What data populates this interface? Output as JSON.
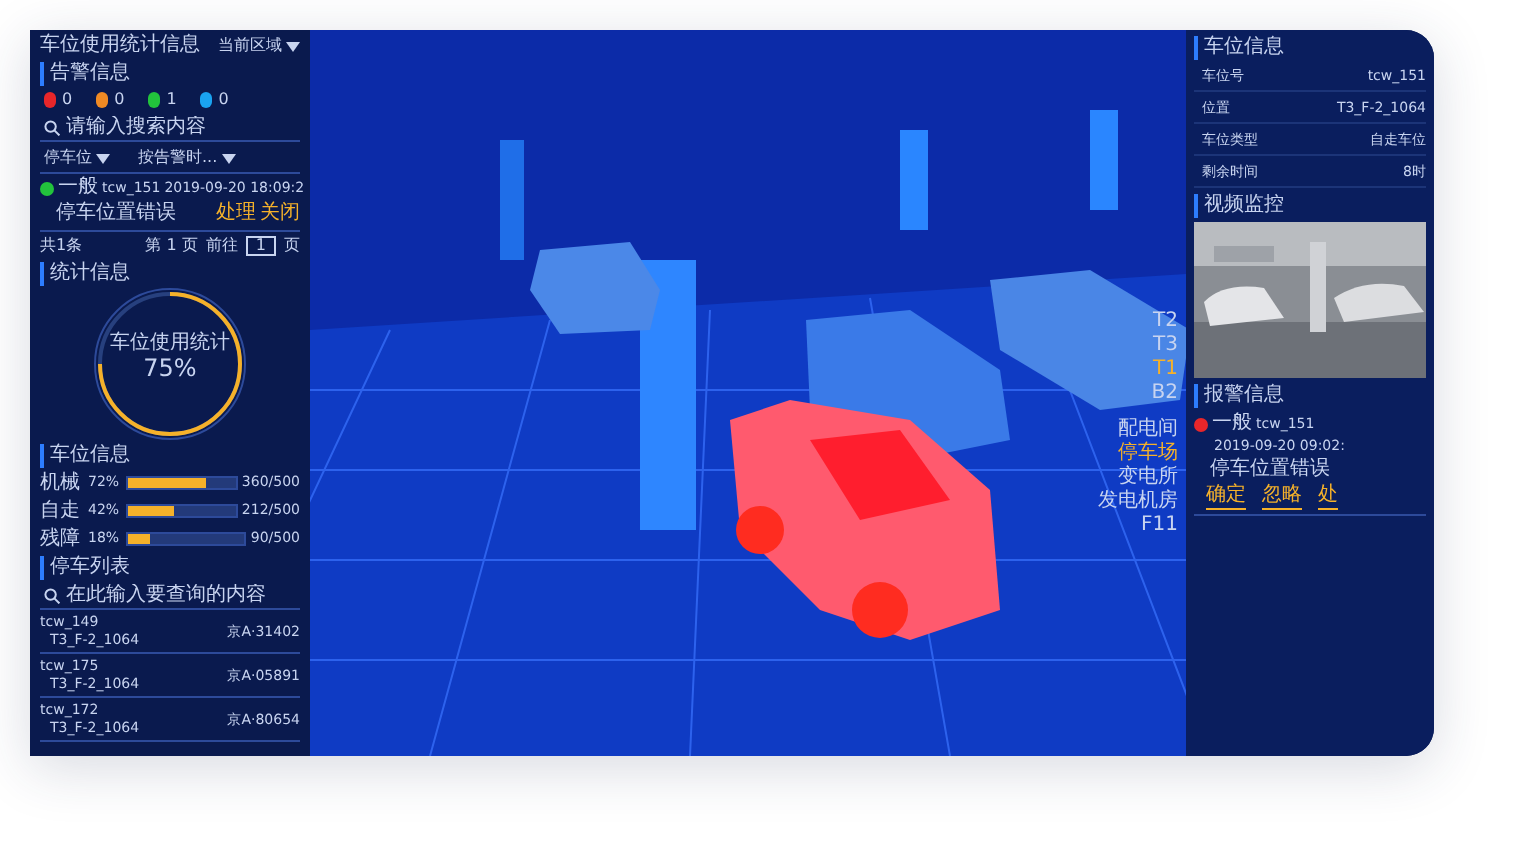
{
  "left": {
    "title": "车位使用统计信息",
    "area_select": "当前区域",
    "alerts": {
      "title": "告警信息",
      "counts": [
        {
          "color": "#e8262a",
          "count": "0"
        },
        {
          "color": "#f08a24",
          "count": "0"
        },
        {
          "color": "#22c33c",
          "count": "1"
        },
        {
          "color": "#1aa3f0",
          "count": "0"
        }
      ],
      "search": {
        "placeholder": "请输入搜索内容"
      },
      "filters": [
        "停车位",
        "按告警时..."
      ],
      "items": [
        {
          "color": "#22c33c",
          "level": "一般",
          "space": "tcw_151",
          "time": "2019-09-20 18:09:2",
          "message": "停车位置错误",
          "actions": [
            "处理",
            "关闭"
          ]
        }
      ],
      "pagination": {
        "total": "共1条",
        "page": "第 1 页",
        "goto": "前往",
        "goto_value": "1",
        "goto_suffix": "页"
      }
    },
    "stats": {
      "title": "统计信息",
      "gauge": {
        "label": "车位使用统计",
        "reading": "75%"
      }
    },
    "spaces": {
      "title": "车位信息",
      "rows": [
        {
          "name": "机械",
          "percent": "72%",
          "level": 0.72,
          "reading": "360/500"
        },
        {
          "name": "自走",
          "percent": "42%",
          "level": 0.42,
          "reading": "212/500"
        },
        {
          "name": "残障",
          "percent": "18%",
          "level": 0.18,
          "reading": "90/500"
        }
      ]
    },
    "parking_list": {
      "title": "停车列表",
      "search": {
        "placeholder": "在此输入要查询的内容"
      },
      "items": [
        {
          "space": "tcw_149",
          "location": "T3_F-2_1064",
          "plate": "京A·31402"
        },
        {
          "space": "tcw_175",
          "location": "T3_F-2_1064",
          "plate": "京A·05891"
        },
        {
          "space": "tcw_172",
          "location": "T3_F-2_1064",
          "plate": "京A·80654"
        }
      ]
    }
  },
  "scene": {
    "floors": [
      {
        "label": "T2",
        "selected": false
      },
      {
        "label": "T3",
        "selected": false
      },
      {
        "label": "T1",
        "selected": true
      },
      {
        "label": "B2",
        "selected": false
      }
    ],
    "buildings": [
      {
        "label": "配电间",
        "selected": false
      },
      {
        "label": "停车场",
        "selected": true
      },
      {
        "label": "变电所",
        "selected": false
      },
      {
        "label": "发电机房",
        "selected": false
      },
      {
        "label": "F11",
        "selected": false
      }
    ]
  },
  "right": {
    "details": {
      "title": "车位信息",
      "rows": [
        {
          "label": "车位号",
          "value": "tcw_151"
        },
        {
          "label": "位置",
          "value": "T3_F-2_1064"
        },
        {
          "label": "车位类型",
          "value": "自走车位"
        },
        {
          "label": "剩余时间",
          "value": "8时"
        }
      ]
    },
    "video": {
      "title": "视频监控"
    },
    "alarms": {
      "title": "报警信息",
      "items": [
        {
          "color": "#e8262a",
          "level": "一般",
          "space": "tcw_151",
          "time": "2019-09-20 09:02:",
          "message": "停车位置错误",
          "actions": [
            "确定",
            "忽略",
            "处"
          ]
        }
      ]
    }
  }
}
